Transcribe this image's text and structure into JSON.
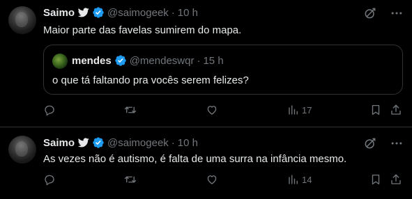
{
  "colors": {
    "background": "#000000",
    "text": "#e7e9ea",
    "muted": "#71767b",
    "border": "#2f3336",
    "verified": "#1d9bf0"
  },
  "tweets": [
    {
      "author": {
        "name": "Saimo",
        "handle": "@saimogeek",
        "time": "10 h"
      },
      "text": "Maior parte das favelas sumirem do mapa.",
      "quote": {
        "author": {
          "name": "mendes",
          "handle": "@mendeswqr",
          "time": "15 h"
        },
        "text": "o que tá faltando pra vocês serem felizes?"
      },
      "stats": {
        "views": "17"
      }
    },
    {
      "author": {
        "name": "Saimo",
        "handle": "@saimogeek",
        "time": "10 h"
      },
      "text": "As vezes não é autismo, é falta de uma surra na infância mesmo.",
      "stats": {
        "views": "14"
      }
    }
  ],
  "separator": "·",
  "icons": [
    "twitter-bird-icon",
    "verified-badge-icon",
    "grok-icon",
    "more-icon",
    "reply-icon",
    "retweet-icon",
    "like-icon",
    "views-icon",
    "bookmark-icon",
    "share-icon"
  ]
}
